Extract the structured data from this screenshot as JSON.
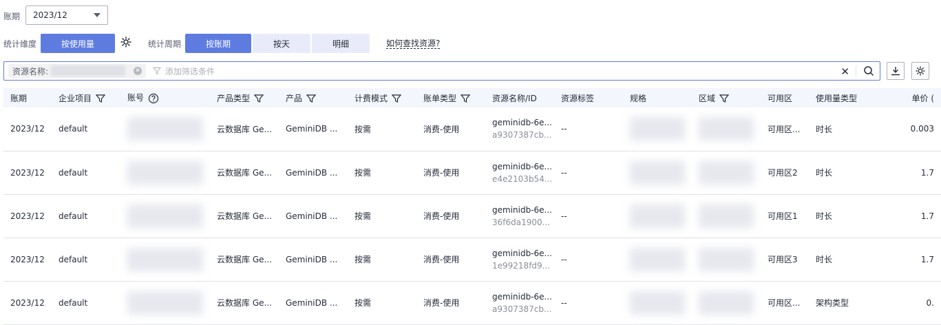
{
  "period": {
    "label": "账期",
    "value": "2023/12"
  },
  "dimension": {
    "label": "统计维度",
    "button": "按使用量"
  },
  "cycle": {
    "label": "统计周期",
    "options": [
      "按账期",
      "按天",
      "明细"
    ]
  },
  "help_link": "如何查找资源?",
  "filter": {
    "tag_label": "资源名称:",
    "placeholder": "添加筛选条件"
  },
  "columns": [
    "账期",
    "企业项目",
    "账号",
    "产品类型",
    "产品",
    "计费模式",
    "账单类型",
    "资源名称/ID",
    "资源标签",
    "规格",
    "区域",
    "可用区",
    "使用量类型",
    "单价 ("
  ],
  "rows": [
    {
      "period": "2023/12",
      "project": "default",
      "product_type": "云数据库 Ge...",
      "product": "GeminiDB ...",
      "billing": "按需",
      "bill_type": "消费-使用",
      "res_name": "geminidb-6e...",
      "res_id": "a9307387cb...",
      "tag": "--",
      "az": "可用区...",
      "usage_type": "时长",
      "price": "0.003"
    },
    {
      "period": "2023/12",
      "project": "default",
      "product_type": "云数据库 Ge...",
      "product": "GeminiDB ...",
      "billing": "按需",
      "bill_type": "消费-使用",
      "res_name": "geminidb-6e...",
      "res_id": "e4e2103b54...",
      "tag": "--",
      "az": "可用区2",
      "usage_type": "时长",
      "price": "1.7"
    },
    {
      "period": "2023/12",
      "project": "default",
      "product_type": "云数据库 Ge...",
      "product": "GeminiDB ...",
      "billing": "按需",
      "bill_type": "消费-使用",
      "res_name": "geminidb-6e...",
      "res_id": "36f6da1900...",
      "tag": "--",
      "az": "可用区1",
      "usage_type": "时长",
      "price": "1.7"
    },
    {
      "period": "2023/12",
      "project": "default",
      "product_type": "云数据库 Ge...",
      "product": "GeminiDB ...",
      "billing": "按需",
      "bill_type": "消费-使用",
      "res_name": "geminidb-6e...",
      "res_id": "1e99218fd9...",
      "tag": "--",
      "az": "可用区3",
      "usage_type": "时长",
      "price": "1.7"
    },
    {
      "period": "2023/12",
      "project": "default",
      "product_type": "云数据库 Ge...",
      "product": "GeminiDB ...",
      "billing": "按需",
      "bill_type": "消费-使用",
      "res_name": "geminidb-6e...",
      "res_id": "a9307387cb...",
      "tag": "--",
      "az": "可用区...",
      "usage_type": "架构类型",
      "price": "0."
    }
  ]
}
